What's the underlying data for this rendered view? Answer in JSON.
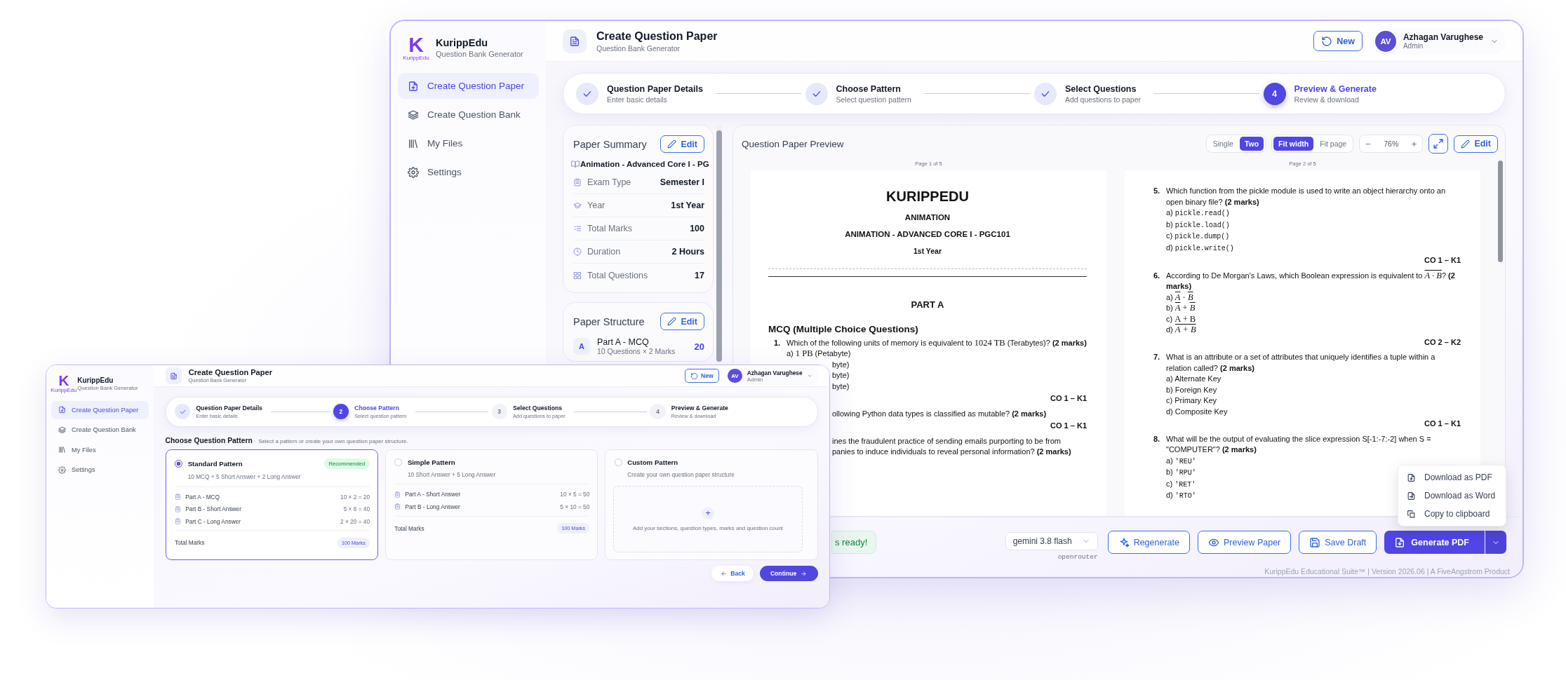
{
  "back_window": {
    "brand": {
      "logo_letter": "K",
      "logo_caption": "KurippEdu",
      "name": "KurippEdu",
      "subtitle": "Question Bank Generator"
    },
    "sidebar": [
      {
        "label": "Create Question Paper",
        "selected": true
      },
      {
        "label": "Create Question Bank",
        "selected": false
      },
      {
        "label": "My Files",
        "selected": false
      },
      {
        "label": "Settings",
        "selected": false
      }
    ],
    "header": {
      "title": "Create Question Paper",
      "subtitle": "Question Bank Generator",
      "new_button": "New",
      "user": {
        "initials": "AV",
        "name": "Azhagan Varughese",
        "role": "Admin"
      }
    },
    "stepper": [
      {
        "title": "Question Paper Details",
        "subtitle": "Enter basic details",
        "completed": true,
        "current": false
      },
      {
        "title": "Choose Pattern",
        "subtitle": "Select question pattern",
        "completed": true,
        "current": false
      },
      {
        "title": "Select Questions",
        "subtitle": "Add questions to paper",
        "completed": true,
        "current": false
      },
      {
        "title": "Preview & Generate",
        "subtitle": "Review & download",
        "completed": false,
        "current": true,
        "number": "4"
      }
    ],
    "paper_summary": {
      "title": "Paper Summary",
      "edit_button": "Edit",
      "course": "Animation - Advanced Core I - PG",
      "rows": [
        {
          "label": "Exam Type",
          "value": "Semester I"
        },
        {
          "label": "Year",
          "value": "1st Year"
        },
        {
          "label": "Total Marks",
          "value": "100"
        },
        {
          "label": "Duration",
          "value": "2 Hours"
        },
        {
          "label": "Total Questions",
          "value": "17"
        }
      ]
    },
    "paper_structure": {
      "title": "Paper Structure",
      "edit_button": "Edit",
      "parts": [
        {
          "letter": "A",
          "name": "Part A - MCQ",
          "detail": "10 Questions × 2 Marks",
          "marks": "20"
        }
      ]
    },
    "preview": {
      "title": "Question Paper Preview",
      "layout_toggle": [
        {
          "label": "Single",
          "selected": false
        },
        {
          "label": "Two",
          "selected": true
        }
      ],
      "fit_toggle": [
        {
          "label": "Fit width",
          "selected": true
        },
        {
          "label": "Fit page",
          "selected": false
        }
      ],
      "zoom_out": "−",
      "zoom": "76%",
      "zoom_in": "+",
      "edit_button": "Edit",
      "pages": [
        {
          "label": "Page 1 of 5",
          "blocks": [
            {
              "kind": "title",
              "text": "KURIPPEDU"
            },
            {
              "kind": "heading",
              "text": "ANIMATION"
            },
            {
              "kind": "heading",
              "text": "ANIMATION - ADVANCED CORE I - PGC101"
            },
            {
              "kind": "subheading",
              "text": "1st Year"
            },
            {
              "kind": "rule"
            },
            {
              "kind": "part",
              "text": "PART A"
            },
            {
              "kind": "section",
              "text": "MCQ (Multiple Choice Questions)"
            },
            {
              "kind": "question",
              "number": "1.",
              "text": "Which of the following units of memory is equivalent to ",
              "math": "1024 TB",
              "after": " (Terabytes)? **(2 marks)**"
            },
            {
              "kind": "math_option",
              "label": "a)",
              "math": "1 PB",
              "text": " (Petabyte)"
            },
            {
              "kind": "fragment",
              "text": "byte)"
            },
            {
              "kind": "fragment",
              "text": "byte)"
            },
            {
              "kind": "fragment",
              "text": "byte)"
            },
            {
              "kind": "co",
              "text": "CO 1 – K1"
            },
            {
              "kind": "fragment",
              "text": "ollowing Python data types is classified as mutable? **(2 marks)**"
            },
            {
              "kind": "co",
              "text": "CO 1 – K1"
            },
            {
              "kind": "fragment",
              "text": "ines the fraudulent practice of sending emails purporting to be from"
            },
            {
              "kind": "fragment",
              "text": "panies to induce individuals to reveal personal information? **(2 marks)**"
            }
          ]
        },
        {
          "label": "Page 2 of 5",
          "blocks": [
            {
              "kind": "question",
              "number": "5.",
              "text": "Which function from the pickle module is used to write an object hierarchy onto an open binary file? **(2 marks)**"
            },
            {
              "kind": "code_option",
              "label": "a)",
              "code": "pickle.read()"
            },
            {
              "kind": "code_option",
              "label": "b)",
              "code": "pickle.load()"
            },
            {
              "kind": "code_option",
              "label": "c)",
              "code": "pickle.dump()"
            },
            {
              "kind": "code_option",
              "label": "d)",
              "code": "pickle.write()"
            },
            {
              "kind": "co",
              "text": "CO 1 – K1"
            },
            {
              "kind": "question",
              "number": "6.",
              "text": "According to De Morgan’s Laws, which Boolean expression is equivalent to ",
              "math": "A · B",
              "overline": true,
              "after": "? **(2 marks)**"
            },
            {
              "kind": "math_option",
              "label": "a)",
              "math": "A · B",
              "overline_letters": true
            },
            {
              "kind": "math_option",
              "label": "b)",
              "math": "A + B",
              "overline_letters": true
            },
            {
              "kind": "math_option",
              "label": "c)",
              "math": "A + B"
            },
            {
              "kind": "math_option",
              "label": "d)",
              "math": "A + B",
              "overline": true
            },
            {
              "kind": "co",
              "text": "CO 2 – K2"
            },
            {
              "kind": "question",
              "number": "7.",
              "text": "What is an attribute or a set of attributes that uniquely identifies a tuple within a relation called? **(2 marks)**"
            },
            {
              "kind": "option",
              "label": "a)",
              "text": "Alternate Key"
            },
            {
              "kind": "option",
              "label": "b)",
              "text": "Foreign Key"
            },
            {
              "kind": "option",
              "label": "c)",
              "text": "Primary Key"
            },
            {
              "kind": "option",
              "label": "d)",
              "text": "Composite Key"
            },
            {
              "kind": "co",
              "text": "CO 1 – K1"
            },
            {
              "kind": "question",
              "number": "8.",
              "text": "What will be the output of evaluating the slice expression S[-1:-7:-2] when S = \"COMPUTER\"? **(2 marks)**"
            },
            {
              "kind": "code_option",
              "label": "a)",
              "code": "'REU'"
            },
            {
              "kind": "code_option",
              "label": "b)",
              "code": "'RPU'"
            },
            {
              "kind": "code_option",
              "label": "c)",
              "code": "'RET'"
            },
            {
              "kind": "code_option",
              "label": "d)",
              "code": "'RTO'"
            }
          ]
        }
      ]
    },
    "bottom_bar": {
      "status": "s ready!",
      "model": "gemini 3.8 flash",
      "provider": "openrouter",
      "buttons": [
        "Regenerate",
        "Preview Paper",
        "Save Draft"
      ],
      "primary_button": "Generate PDF",
      "menu": [
        "Download as PDF",
        "Download as Word",
        "Copy to clipboard"
      ]
    },
    "footer": "KurippEdu Educational Suite™ | Version 2026.06 | A FiveAngstrom Product"
  },
  "front_window": {
    "brand": {
      "logo_letter": "K",
      "logo_caption": "KurippEdu",
      "name": "KurippEdu",
      "subtitle": "Question Bank Generator"
    },
    "sidebar": [
      {
        "label": "Create Question Paper",
        "selected": true
      },
      {
        "label": "Create Question Bank",
        "selected": false
      },
      {
        "label": "My Files",
        "selected": false
      },
      {
        "label": "Settings",
        "selected": false
      }
    ],
    "header": {
      "title": "Create Question Paper",
      "subtitle": "Question Bank Generator",
      "new_button": "New",
      "user": {
        "initials": "AV",
        "name": "Azhagan Varughese",
        "role": "Admin"
      }
    },
    "stepper": [
      {
        "title": "Question Paper Details",
        "subtitle": "Enter basic details",
        "completed": true,
        "current": false
      },
      {
        "title": "Choose Pattern",
        "subtitle": "Select question pattern",
        "completed": false,
        "current": true,
        "number": "2"
      },
      {
        "title": "Select Questions",
        "subtitle": "Add questions to paper",
        "completed": false,
        "current": false,
        "number": "3"
      },
      {
        "title": "Preview & Generate",
        "subtitle": "Review & download",
        "completed": false,
        "current": false,
        "number": "4"
      }
    ],
    "pattern_heading": "Choose Question Pattern",
    "pattern_hint": "Select a pattern or create your own question paper structure.",
    "patterns": [
      {
        "kind": "preset",
        "name": "Standard Pattern",
        "badge": "Recommended",
        "summary": "10 MCQ + 5 Short Answer + 2 Long Answer",
        "selected": true,
        "parts": [
          {
            "name": "Part A - MCQ",
            "calc": "10 × 2 = 20"
          },
          {
            "name": "Part B - Short Answer",
            "calc": "5 × 8 = 40"
          },
          {
            "name": "Part C - Long Answer",
            "calc": "2 × 20 = 40"
          }
        ],
        "total_label": "Total Marks",
        "total": "100 Marks"
      },
      {
        "kind": "preset",
        "name": "Simple Pattern",
        "summary": "10 Short Answer + 5 Long Answer",
        "selected": false,
        "parts": [
          {
            "name": "Part A - Short Answer",
            "calc": "10 × 5 = 50"
          },
          {
            "name": "Part B - Long Answer",
            "calc": "5 × 10 = 50"
          }
        ],
        "total_label": "Total Marks",
        "total": "100 Marks"
      },
      {
        "kind": "custom",
        "name": "Custom Pattern",
        "summary": "Create your own question paper structure",
        "selected": false,
        "plus": "+",
        "prompt": "Add your sections, question types, marks and question count"
      }
    ],
    "back_button": "Back",
    "continue_button": "Continue"
  }
}
